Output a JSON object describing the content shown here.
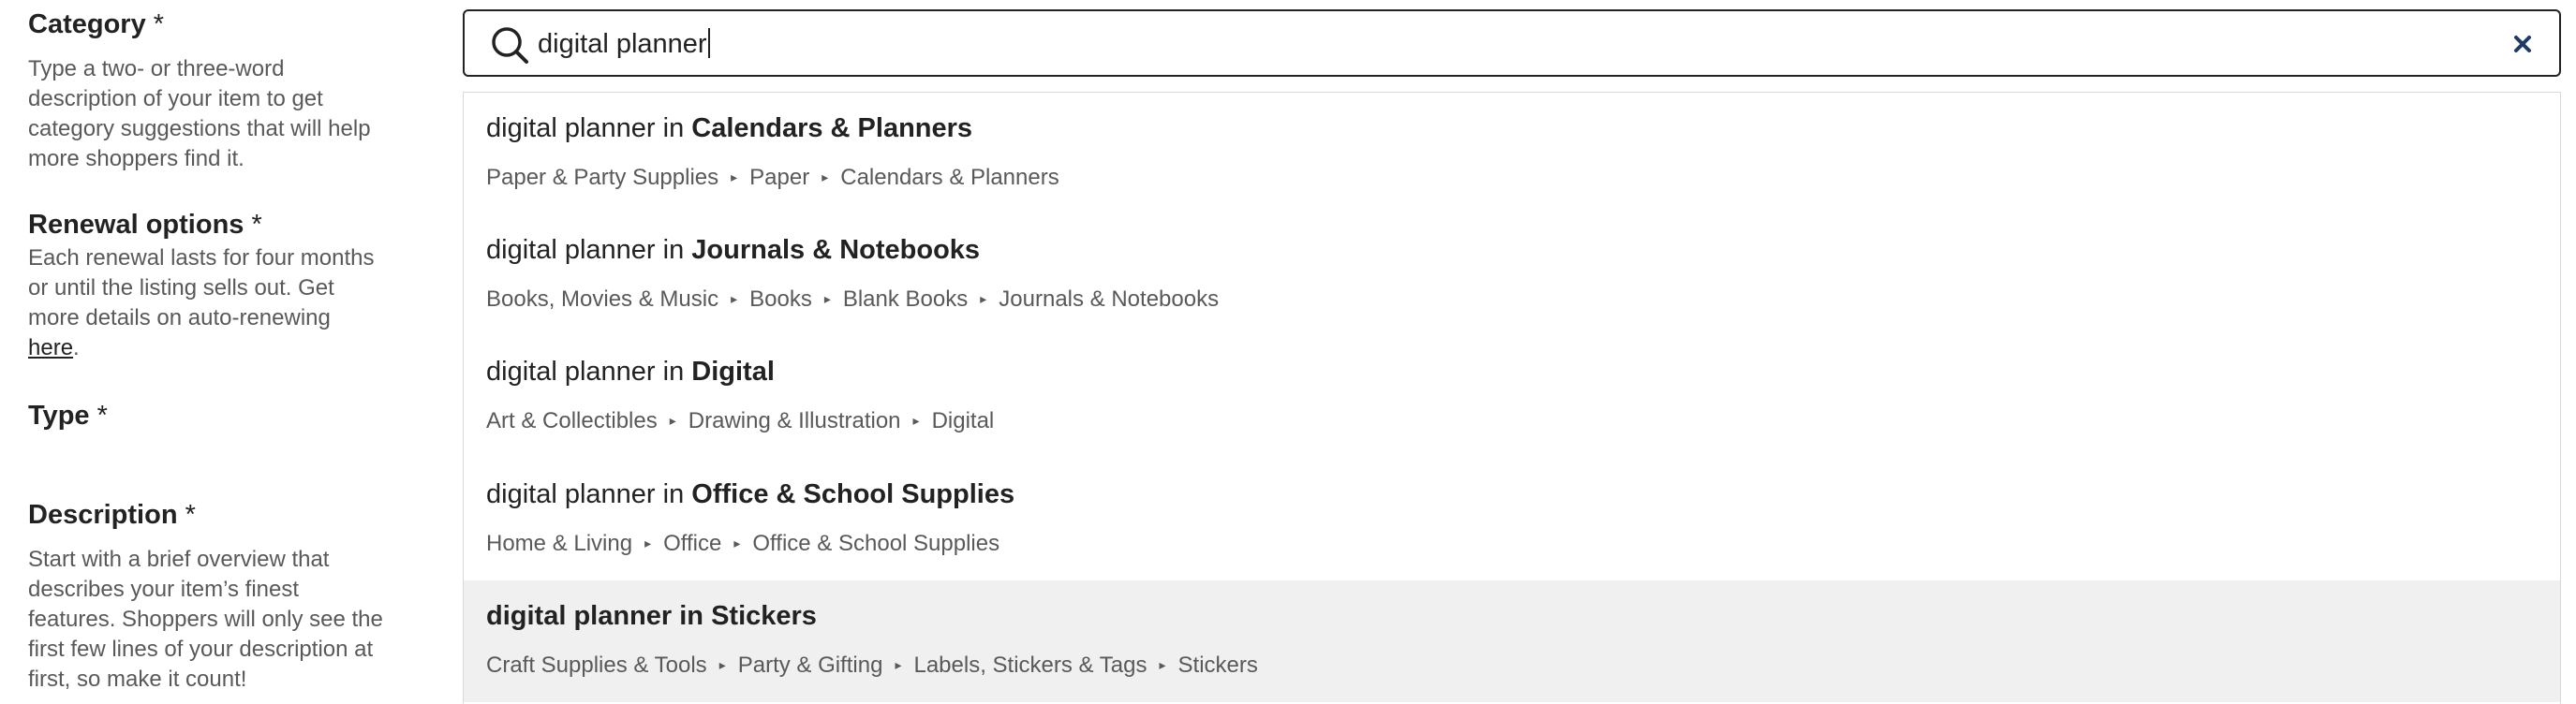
{
  "left": {
    "category": {
      "title": "Category",
      "required_mark": "*",
      "help": "Type a two- or three-word description of your item to get category suggestions that will help more shoppers find it."
    },
    "renewal": {
      "title": "Renewal options",
      "required_mark": "*",
      "help_prefix": "Each renewal lasts for four months or until the listing sells out. Get more details on auto-renewing ",
      "help_link": "here",
      "help_suffix": "."
    },
    "type": {
      "title": "Type",
      "required_mark": "*"
    },
    "description": {
      "title": "Description",
      "required_mark": "*",
      "help": "Start with a brief overview that describes your item’s finest features. Shoppers will only see the first few lines of your description at first, so make it count!"
    }
  },
  "search": {
    "value": "digital planner",
    "icon": "search-icon",
    "clear_icon": "close-icon"
  },
  "suggestions": [
    {
      "prefix": "digital planner in ",
      "category": "Calendars & Planners",
      "path": [
        "Paper & Party Supplies",
        "Paper",
        "Calendars & Planners"
      ],
      "active": false
    },
    {
      "prefix": "digital planner in ",
      "category": "Journals & Notebooks",
      "path": [
        "Books, Movies & Music",
        "Books",
        "Blank Books",
        "Journals & Notebooks"
      ],
      "active": false
    },
    {
      "prefix": "digital planner in ",
      "category": "Digital",
      "path": [
        "Art & Collectibles",
        "Drawing & Illustration",
        "Digital"
      ],
      "active": false
    },
    {
      "prefix": "digital planner in ",
      "category": "Office & School Supplies",
      "path": [
        "Home & Living",
        "Office",
        "Office & School Supplies"
      ],
      "active": false
    },
    {
      "prefix": "digital planner in ",
      "category": "Stickers",
      "path": [
        "Craft Supplies & Tools",
        "Party & Gifting",
        "Labels, Stickers & Tags",
        "Stickers"
      ],
      "active": true
    }
  ],
  "separator_glyph": "▸",
  "colors": {
    "text": "#222222",
    "muted": "#595959",
    "highlight_bg": "#f0f0f0",
    "border": "#222222"
  }
}
